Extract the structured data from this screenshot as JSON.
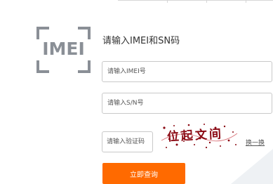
{
  "badge": {
    "text": "IMEI"
  },
  "title": "请输入IMEI和SN码",
  "form": {
    "imei_placeholder": "请输入IMEI号",
    "sn_placeholder": "请输入S/N号",
    "captcha_placeholder": "请输入验证码",
    "captcha_text": "位起文间",
    "refresh_label": "换一换",
    "submit_label": "立即查询"
  },
  "colors": {
    "accent": "#ff6a00",
    "badge_gray": "#8a8f96",
    "captcha_ink": "#8b0a14",
    "captcha_red": "#c0121e"
  },
  "icons": [
    "imei-scan-icon"
  ]
}
